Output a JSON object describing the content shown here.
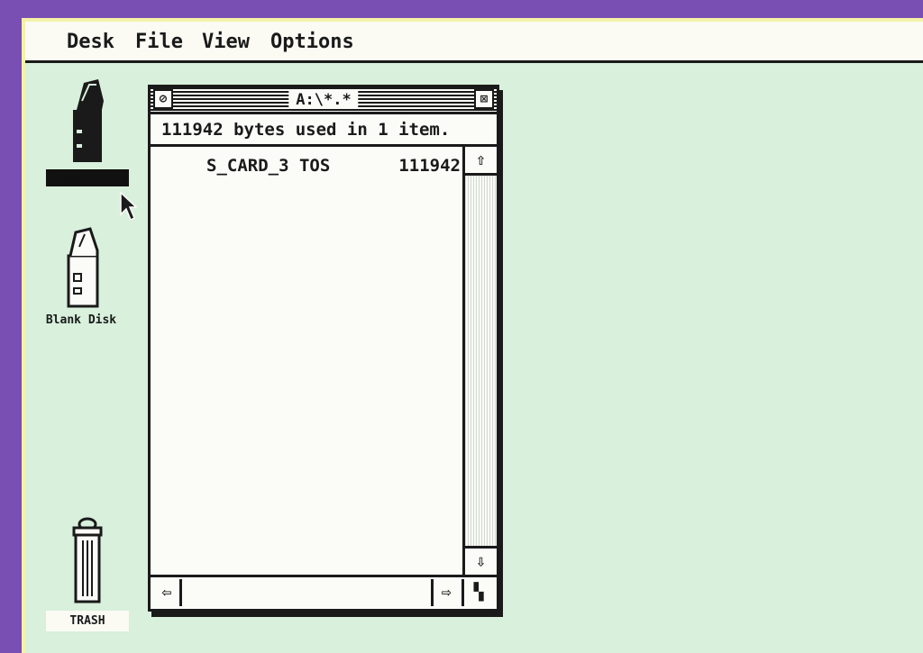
{
  "menubar": {
    "items": [
      {
        "label": "Desk"
      },
      {
        "label": "File"
      },
      {
        "label": "View"
      },
      {
        "label": "Options"
      }
    ]
  },
  "desktop": {
    "icons": [
      {
        "label": "Floppy Disk",
        "selected": true
      },
      {
        "label": "Blank Disk",
        "selected": false
      },
      {
        "label": "TRASH",
        "selected": false
      }
    ]
  },
  "window": {
    "title": "A:\\*.*",
    "closer_glyph": "⊘",
    "fuller_glyph": "⊠",
    "info": "111942 bytes used in 1 item.",
    "files": [
      {
        "name": "S_CARD_3 TOS",
        "size": "111942"
      }
    ],
    "scroll_up_glyph": "⇧",
    "scroll_down_glyph": "⇩",
    "scroll_left_glyph": "⇦",
    "scroll_right_glyph": "⇨",
    "sizer_glyph": "▚"
  },
  "colors": {
    "desktop": "#d8f0dc",
    "frame": "#7a4fb3",
    "ink": "#1a1a1a"
  }
}
